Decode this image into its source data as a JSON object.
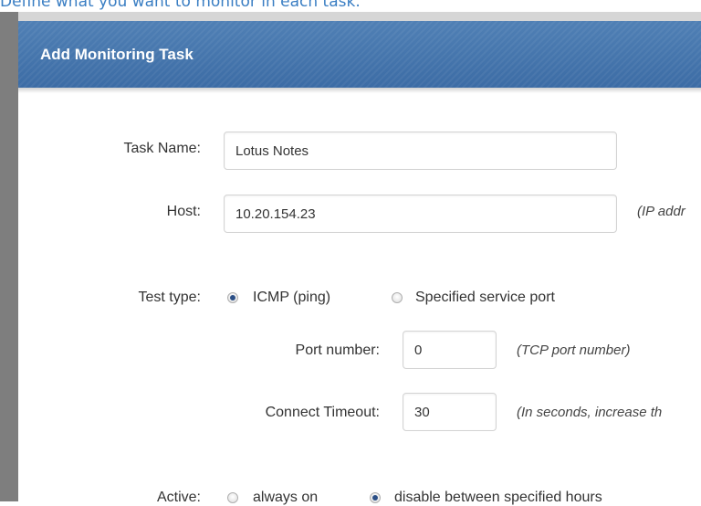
{
  "caption": "Define what you want to monitor in each task.",
  "dialog": {
    "title": "Add Monitoring Task"
  },
  "form": {
    "task_name": {
      "label": "Task Name:",
      "value": "Lotus Notes"
    },
    "host": {
      "label": "Host:",
      "value": "10.20.154.23",
      "hint": "(IP addr"
    },
    "test_type": {
      "label": "Test type:",
      "options": [
        "ICMP (ping)",
        "Specified service port"
      ],
      "selected": "ICMP (ping)"
    },
    "port_number": {
      "label": "Port number:",
      "value": "0",
      "hint": "(TCP port number)"
    },
    "connect_timeout": {
      "label": "Connect Timeout:",
      "value": "30",
      "hint": "(In seconds, increase th"
    },
    "active": {
      "label": "Active:",
      "options": [
        "always on",
        "disable between specified hours"
      ],
      "selected": "disable between specified hours"
    }
  }
}
